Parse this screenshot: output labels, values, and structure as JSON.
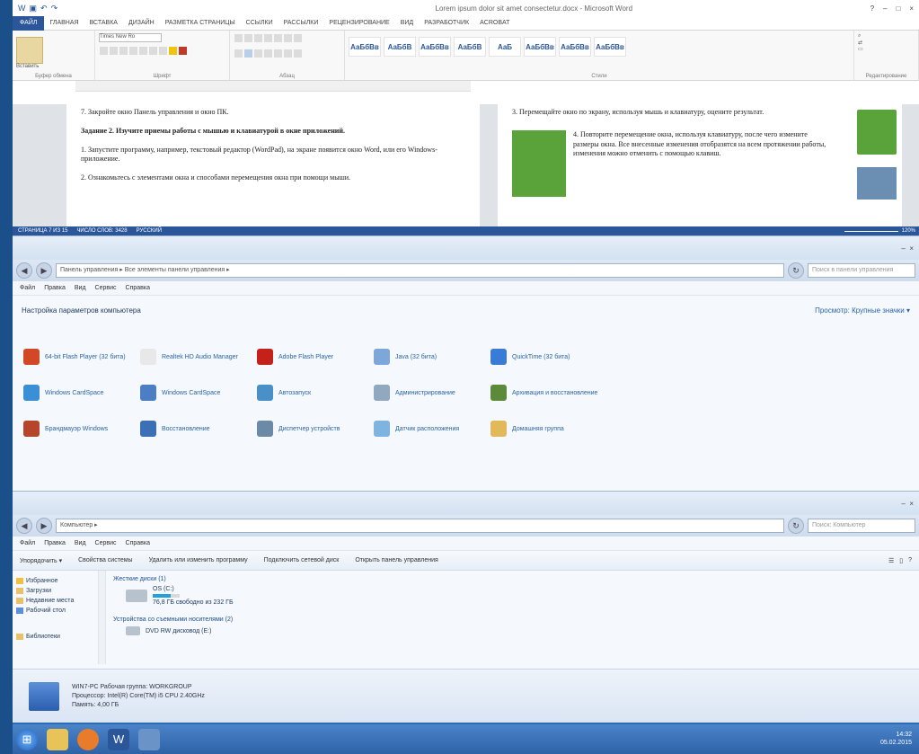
{
  "word": {
    "title": "Lorem ipsum dolor sit amet consectetur.docx - Microsoft Word",
    "tabs": [
      "ФАЙЛ",
      "ГЛАВНАЯ",
      "ВСТАВКА",
      "ДИЗАЙН",
      "РАЗМЕТКА СТРАНИЦЫ",
      "ССЫЛКИ",
      "РАССЫЛКИ",
      "РЕЦЕНЗИРОВАНИЕ",
      "ВИД",
      "РАЗРАБОТЧИК",
      "ACROBAT"
    ],
    "groups": [
      "Буфер обмена",
      "Шрифт",
      "Абзац",
      "Стили",
      "Редактирование"
    ],
    "paste_label": "Вставить",
    "font_name": "Times New Ro",
    "style_names": [
      "АаБбВв",
      "АаБбВ",
      "АаБбВв",
      "АаБбВ",
      "АаБ",
      "АаБбВв",
      "АаБбВв",
      "АаБбВв"
    ],
    "left_page": {
      "p1": "7. Закройте окно Панель управления и окно ПК.",
      "heading": "Задание 2. Изучите приемы работы с мышью и клавиатурой в окне приложений.",
      "p2": "1. Запустите программу, например, текстовый редактор (WordPad), на экране появится окно Word, или его Windows-приложение.",
      "p3": "2. Ознакомьтесь с элементами окна и способами перемещения окна при помощи мыши."
    },
    "right_page": {
      "p1": "3. Перемещайте окно по экрану, используя мышь и клавиатуру, оцените результат.",
      "p2": "4. Повторите перемещение окна, используя клавиатуру, после чего измените размеры окна. Все внесенные изменения отобразятся на всем протяжении работы, изменения можно отменить с помощью клавиш."
    },
    "status": {
      "page": "СТРАНИЦА 7 ИЗ 15",
      "words": "ЧИСЛО СЛОВ: 3428",
      "lang": "РУССКИЙ",
      "zoom": "120%"
    }
  },
  "control_panel": {
    "address": "Панель управления ▸ Все элементы панели управления ▸",
    "search_placeholder": "Поиск в панели управления",
    "menu": [
      "Файл",
      "Правка",
      "Вид",
      "Сервис",
      "Справка"
    ],
    "heading": "Настройка параметров компьютера",
    "view_by": "Просмотр: Крупные значки ▾",
    "items": [
      {
        "label": "64-bit Flash Player (32 бита)",
        "color": "#d24726"
      },
      {
        "label": "Realtek HD Audio Manager",
        "color": "#e8e8e8"
      },
      {
        "label": "Adobe Flash Player",
        "color": "#c4211b"
      },
      {
        "label": "Java (32 бита)",
        "color": "#7da7d9"
      },
      {
        "label": "QuickTime (32 бита)",
        "color": "#3a7bd5"
      },
      {
        "label": "Windows CardSpace",
        "color": "#3b8fd4"
      },
      {
        "label": "Windows CardSpace",
        "color": "#4c7ec6"
      },
      {
        "label": "Автозапуск",
        "color": "#4a90c8"
      },
      {
        "label": "Администрирование",
        "color": "#90a8c0"
      },
      {
        "label": "Архивация и восстановление",
        "color": "#5a8a3a"
      },
      {
        "label": "Брандмауэр Windows",
        "color": "#b5462b"
      },
      {
        "label": "Восстановление",
        "color": "#3b6fb6"
      },
      {
        "label": "Диспетчер устройств",
        "color": "#6a8aa8"
      },
      {
        "label": "Датчик расположения",
        "color": "#7fb3e0"
      },
      {
        "label": "Домашняя группа",
        "color": "#e2b95a"
      }
    ]
  },
  "computer": {
    "address": "Компьютер ▸",
    "search_placeholder": "Поиск: Компьютер",
    "menu": [
      "Файл",
      "Правка",
      "Вид",
      "Сервис",
      "Справка"
    ],
    "toolbar": [
      "Упорядочить ▾",
      "Свойства системы",
      "Удалить или изменить программу",
      "Подключить сетевой диск",
      "Открыть панель управления"
    ],
    "nav": [
      "Избранное",
      "Загрузки",
      "Недавние места",
      "Рабочий стол",
      "Библиотеки"
    ],
    "group_hdd": "Жесткие диски (1)",
    "drive_name": "OS (C:)",
    "drive_free": "76,8 ГБ свободно из 232 ГБ",
    "drive_used_fraction": 0.67,
    "group_removable": "Устройства со съемными носителями (2)",
    "dvd_label": "DVD RW дисковод (E:)",
    "details": {
      "name": "WIN7-PC  Рабочая группа: WORKGROUP",
      "cpu": "Процессор: Intel(R) Core(TM) i5 CPU 2.40GHz",
      "ram": "Память: 4,00 ГБ"
    }
  },
  "taskbar": {
    "time": "14:32",
    "date": "05.02.2015"
  }
}
